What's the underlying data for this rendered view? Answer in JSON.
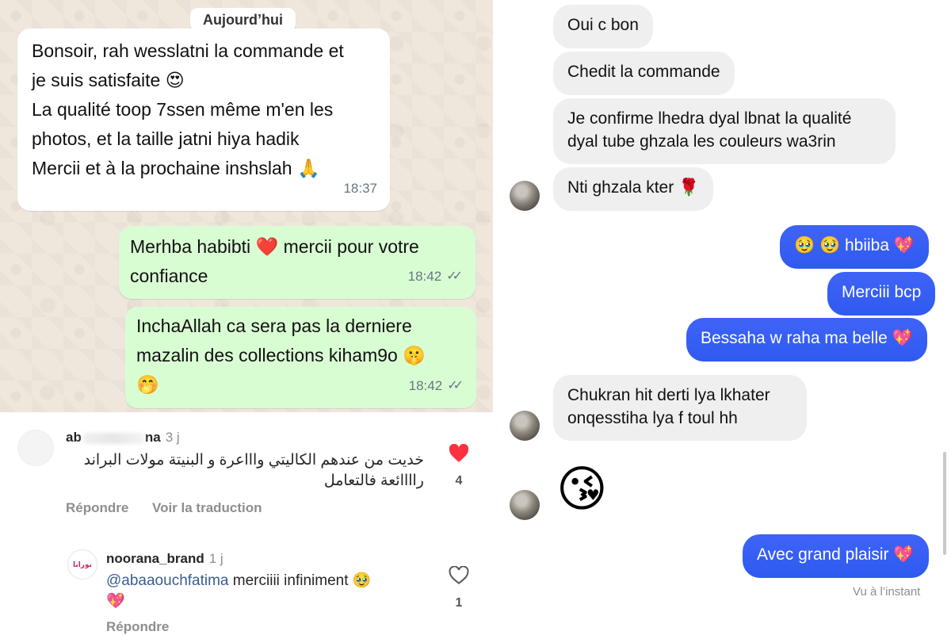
{
  "whatsapp": {
    "date_label": "Aujourd’hui",
    "messages": [
      {
        "direction": "in",
        "text": "Bonsoir, rah wesslatni la commande et\nje suis satisfaite 😍\nLa qualité toop 7ssen même m'en les\nphotos, et la taille jatni hiya hadik\nMercii et à la prochaine inshslah 🙏",
        "time": "18:37"
      },
      {
        "direction": "out",
        "text": "Merhba habibti ❤️ mercii pour votre\nconfiance",
        "time": "18:42",
        "ticks": "✓✓"
      },
      {
        "direction": "out",
        "text": "InchaAllah ca sera pas la derniere\nmazalin des collections kiham9o 🤫\n🤭",
        "time": "18:42",
        "ticks": "✓✓"
      }
    ]
  },
  "instagram": {
    "comment": {
      "username_prefix": "ab",
      "username_suffix": "na",
      "time": "3 j",
      "text_line1": "خديت من عندهم الكاليتي واااعرة و البنيتة مولات البراند",
      "text_line2": "راااائعة فالتعامل",
      "like_icon": "heart-filled-icon",
      "like_count": "4",
      "reply_label": "Répondre",
      "translate_label": "Voir la traduction"
    },
    "reply": {
      "username": "noorana_brand",
      "time": "1 j",
      "avatar_text": "نورانا",
      "mention": "@abaaouchfatima",
      "text": " merciiii infiniment 🥹",
      "text_line2": "💖",
      "like_icon": "heart-outline-icon",
      "like_count": "1",
      "reply_label": "Répondre"
    }
  },
  "messenger": {
    "messages": [
      {
        "direction": "in",
        "text": "Oui c bon"
      },
      {
        "direction": "in",
        "text": "Chedit la commande"
      },
      {
        "direction": "in",
        "text": "Je confirme lhedra dyal lbnat la qualité\ndyal tube ghzala les couleurs wa3rin"
      },
      {
        "direction": "in",
        "text": "Nti ghzala kter 🌹"
      },
      {
        "direction": "out",
        "text": "🥹 🥹 hbiiba 💖"
      },
      {
        "direction": "out",
        "text": "Merciii bcp"
      },
      {
        "direction": "out",
        "text": "Bessaha w raha ma belle 💖"
      },
      {
        "direction": "in",
        "text": "Chukran hit derti lya lkhater\nonqesstiha lya f toul hh"
      },
      {
        "direction": "in",
        "text": "😘"
      },
      {
        "direction": "out",
        "text": "Avec grand plaisir 💖"
      }
    ],
    "status": "Vu à l’instant"
  },
  "colors": {
    "wa_in": "#ffffff",
    "wa_out": "#d9fdd3",
    "ms_out": "#3b5bfb",
    "ms_in": "#efefef",
    "ig_heart": "#ff3040"
  }
}
